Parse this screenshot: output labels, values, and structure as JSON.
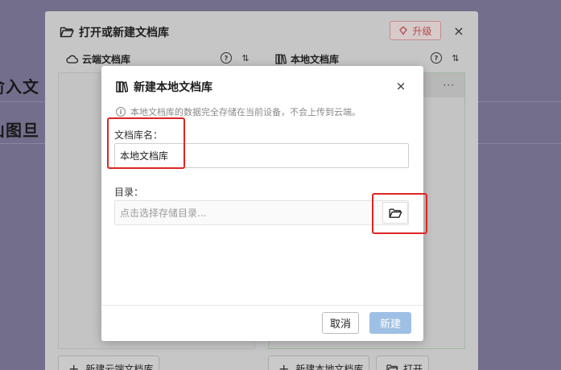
{
  "background": {
    "line1": "俞入文",
    "line2": "山图旦"
  },
  "outer_dialog": {
    "title": "打开或新建文档库",
    "upgrade_label": "升级",
    "close_glyph": "×",
    "cloud_panel_title": "云端文档库",
    "local_panel_title": "本地文档库",
    "help_glyph": "?",
    "sort_glyph": "⇅",
    "more_glyph": "···",
    "new_cloud_button": "新建云端文档库",
    "new_local_button": "新建本地文档库",
    "open_button": "打开"
  },
  "modal": {
    "title": "新建本地文档库",
    "close_glyph": "×",
    "info_glyph": "i",
    "info_text": "本地文档库的数据完全存储在当前设备，不会上传到云端。",
    "name_label": "文档库名：",
    "name_value": "本地文档库",
    "dir_label": "目录：",
    "dir_placeholder": "点击选择存储目录...",
    "cancel_label": "取消",
    "create_label": "新建"
  },
  "colors": {
    "overlay": "#736e8c",
    "accent_red": "#e02424",
    "create_button": "#9ec0e4"
  }
}
